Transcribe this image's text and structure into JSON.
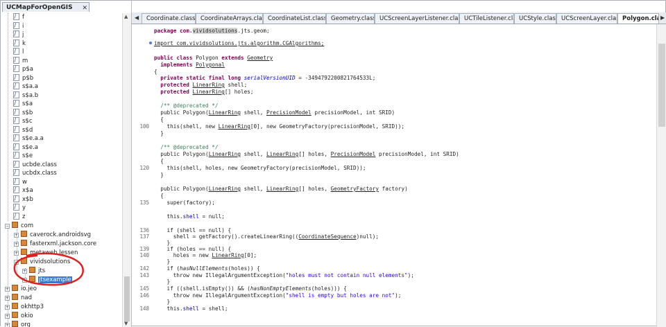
{
  "project_tab": {
    "title": "UCMapForOpenGIS",
    "close": "✕"
  },
  "tree": {
    "files": [
      "f",
      "i",
      "j",
      "k",
      "l",
      "m",
      "p$a",
      "p$b",
      "s$a.a",
      "s$a.b",
      "s$a",
      "s$b",
      "s$c",
      "s$d",
      "s$e.a.a",
      "s$e.a",
      "s$e",
      "ucbde.class",
      "ucbdx.class",
      "w",
      "x$a",
      "x$b",
      "y",
      "z"
    ],
    "com_label": "com",
    "com_children": [
      "caverock.androidsvg",
      "fasterxml.jackson.core",
      "metaweb.lessen",
      "vividsolutions"
    ],
    "vivid_children": [
      "jts",
      "jtsexample"
    ],
    "top_packages": [
      "io.jeo",
      "nad",
      "okhttp3",
      "okio",
      "org"
    ]
  },
  "editor_tabs": [
    "Coordinate.class",
    "CoordinateArrays.class",
    "CoordinateList.class",
    "Geometry.class",
    "UCScreenLayerListener.class",
    "UCTileListener.class",
    "UCStyle.class",
    "UCScreenLayer.class",
    "Polygon.class"
  ],
  "active_tab": "Polygon.class",
  "code": {
    "package": [
      "package com.",
      "vividsolutions",
      ".jts.geom;"
    ],
    "import": "import com.vividsolutions.jts.algorithm.CGAlgorithms;",
    "class_decl": [
      "public class ",
      "Polygon",
      " extends ",
      "Geometry"
    ],
    "implements": [
      "  implements ",
      "Polygonal"
    ],
    "open_brace": "{",
    "field1": [
      "  private static final long ",
      "serialVersionUID",
      " = -3494792200821764533L;"
    ],
    "field2": [
      "  protected ",
      "LinearRing",
      " shell;"
    ],
    "field3": [
      "  protected ",
      "LinearRing",
      "[] holes;"
    ],
    "dep1": "  /** @deprecated */",
    "ctor1": [
      "  public Polygon(",
      "LinearRing",
      " shell, ",
      "PrecisionModel",
      " precisionModel, int SRID)"
    ],
    "brace_open": "  {",
    "ctor1_body": [
      "    this(shell, new ",
      "LinearRing",
      "[0], new GeometryFactory(precisionModel, SRID));"
    ],
    "brace_close": "  }",
    "dep2": "  /** @deprecated */",
    "ctor2": [
      "  public Polygon(",
      "LinearRing",
      " shell, ",
      "LinearRing",
      "[] holes, ",
      "PrecisionModel",
      " precisionModel, int SRID)"
    ],
    "ctor2_body": "    this(shell, holes, new GeometryFactory(precisionModel, SRID));",
    "ctor3": [
      "  public Polygon(",
      "LinearRing",
      " shell, ",
      "LinearRing",
      "[] holes, ",
      "GeometryFactory",
      " factory)"
    ],
    "super": "    super(factory);",
    "shell_null": [
      "    this.",
      "shell",
      " = null;"
    ],
    "if_shell": [
      "    if (shell == null) {"
    ],
    "shell_assign": [
      "      shell = getFactory().createLinearRing((",
      "CoordinateSequence",
      ")null);"
    ],
    "close_brace_i": "    }",
    "if_holes": "    if (holes == null) {",
    "holes_assign": [
      "      holes = new ",
      "LinearRing",
      "[0];"
    ],
    "if_hasnull": [
      "    if (",
      "hasNullElements",
      "(holes)) {"
    ],
    "throw1": [
      "      throw new IllegalArgumentException(",
      "\"holes must not contain null elements\"",
      ");"
    ],
    "if_empty": [
      "    if ((shell.isEmpty()) && (",
      "hasNonEmptyElements",
      "(holes))) {"
    ],
    "throw2": [
      "      throw new IllegalArgumentException(",
      "\"shell is empty but holes are not\"",
      ");"
    ],
    "shell_set": [
      "    this.",
      "shell",
      " = shell;"
    ],
    "line_numbers": {
      "l100": "100",
      "l120": "120",
      "l135": "135",
      "l136": "136",
      "l137": "137",
      "l139": "139",
      "l140": "140",
      "l142": "142",
      "l143": "143",
      "l145": "145",
      "l146": "146",
      "l148": "148"
    }
  },
  "colors": {
    "annotation": "#e02020",
    "selection": "#3778d5"
  }
}
